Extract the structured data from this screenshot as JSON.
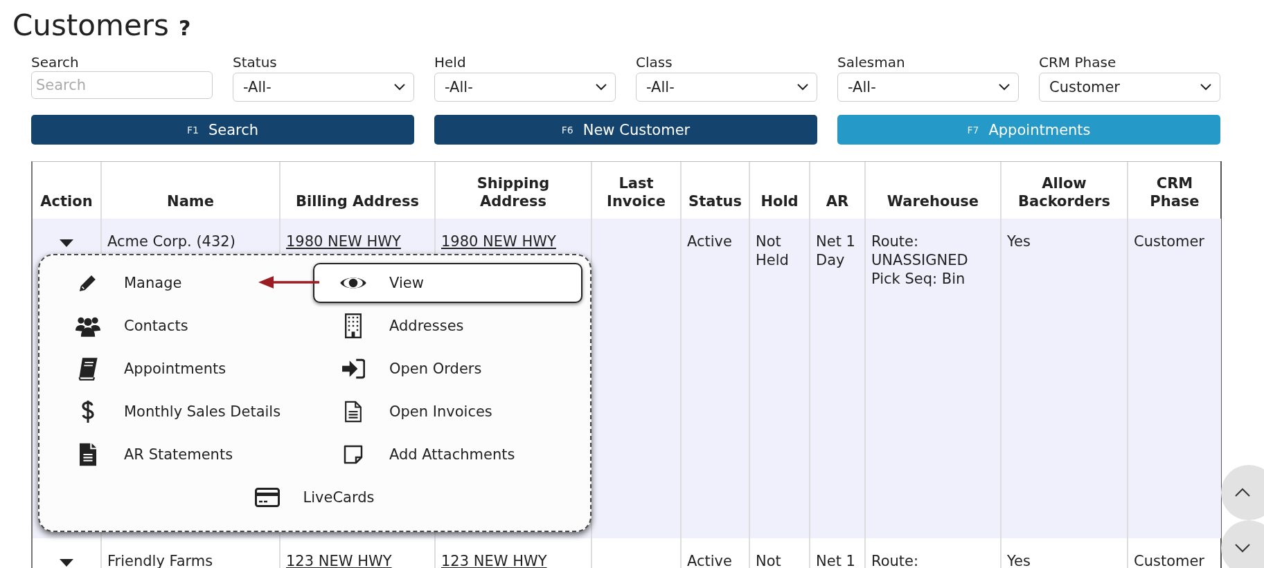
{
  "page": {
    "title": "Customers",
    "help": "?"
  },
  "filters": [
    {
      "kind": "text",
      "label": "Search",
      "placeholder": "Search"
    },
    {
      "kind": "select",
      "label": "Status",
      "value": "-All-"
    },
    {
      "kind": "select",
      "label": "Held",
      "value": "-All-"
    },
    {
      "kind": "select",
      "label": "Class",
      "value": "-All-"
    },
    {
      "kind": "select",
      "label": "Salesman",
      "value": "-All-"
    },
    {
      "kind": "select",
      "label": "CRM Phase",
      "value": "Customer"
    }
  ],
  "buttons": [
    {
      "key": "F1",
      "label": "Search",
      "kind": "primary"
    },
    {
      "key": "F6",
      "label": "New Customer",
      "kind": "primary"
    },
    {
      "key": "F7",
      "label": "Appointments",
      "kind": "secondary"
    }
  ],
  "table": {
    "columns": [
      {
        "label": "Action",
        "kind": "action"
      },
      {
        "label": "Name",
        "kind": "text"
      },
      {
        "label": "Billing Address",
        "kind": "link"
      },
      {
        "label": "Shipping\nAddress",
        "kind": "link"
      },
      {
        "label": "Last\nInvoice",
        "kind": "text"
      },
      {
        "label": "Status",
        "kind": "text"
      },
      {
        "label": "Hold",
        "kind": "text"
      },
      {
        "label": "AR",
        "kind": "text"
      },
      {
        "label": "Warehouse",
        "kind": "text"
      },
      {
        "label": "Allow\nBackorders",
        "kind": "text"
      },
      {
        "label": "CRM\nPhase",
        "kind": "text"
      }
    ],
    "rows": [
      {
        "selected": true,
        "cells": [
          "",
          "Acme Corp. (432)",
          "1980 NEW HWY",
          "1980 NEW HWY",
          "",
          "Active",
          "Not\nHeld",
          "Net 1\nDay",
          "Route:\nUNASSIGNED\nPick Seq: Bin",
          "Yes",
          "Customer"
        ]
      },
      {
        "selected": false,
        "cells": [
          "",
          "Friendly Farms",
          "123 NEW HWY",
          "123 NEW HWY",
          "",
          "Active",
          "Not",
          "Net 1",
          "Route:",
          "Yes",
          "Customer"
        ]
      }
    ]
  },
  "action_menu": {
    "items": [
      {
        "label": "Manage",
        "focused": false
      },
      {
        "label": "View",
        "focused": true
      },
      {
        "label": "Contacts",
        "focused": false
      },
      {
        "label": "Addresses",
        "focused": false
      },
      {
        "label": "Appointments",
        "focused": false
      },
      {
        "label": "Open Orders",
        "focused": false
      },
      {
        "label": "Monthly Sales Details",
        "focused": false
      },
      {
        "label": "Open Invoices",
        "focused": false
      },
      {
        "label": "AR Statements",
        "focused": false
      },
      {
        "label": "Add Attachments",
        "focused": false
      },
      {
        "label": "LiveCards",
        "focused": false
      }
    ]
  }
}
